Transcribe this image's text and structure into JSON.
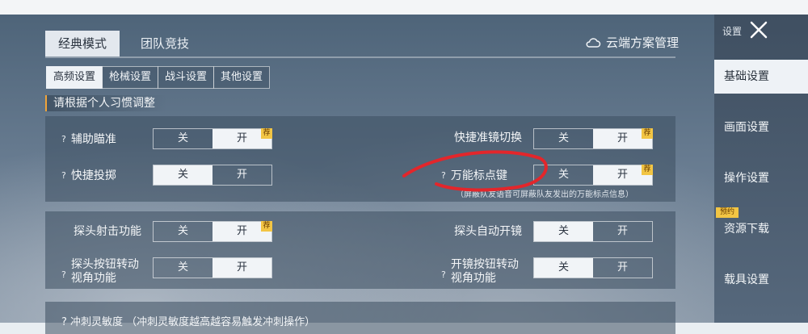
{
  "mode_tabs": [
    "经典模式",
    "团队竞技"
  ],
  "cloud_label": "云端方案管理",
  "sub_tabs": [
    "高频设置",
    "枪械设置",
    "战斗设置",
    "其他设置"
  ],
  "hint": "请根据个人习惯调整",
  "toggle": {
    "off": "关",
    "on": "开",
    "recommend": "荐"
  },
  "panel1": {
    "aim_assist": "辅助瞄准",
    "quick_throw": "快捷投掷",
    "quick_scope_switch": "快捷准镜切换",
    "universal_marker": "万能标点键",
    "marker_note": "（屏蔽队友语音可屏蔽队友发出的万能标点信息）"
  },
  "panel2": {
    "peek_fire": "探头射击功能",
    "peek_button_rotate_1": "探头按钮转动",
    "peek_button_rotate_2": "视角功能",
    "peek_auto_scope": "探头自动开镜",
    "scope_button_rotate_1": "开镜按钮转动",
    "scope_button_rotate_2": "视角功能"
  },
  "panel3": {
    "text": "? 冲刺灵敏度 （冲刺灵敏度越高越容易触发冲刺操作）"
  },
  "sidebar": {
    "title": "设置",
    "items": [
      "基础设置",
      "画面设置",
      "操作设置",
      "资源下载",
      "载具设置"
    ],
    "badge": "预约"
  },
  "states": {
    "aim_assist": "on",
    "quick_throw": "off",
    "quick_scope_switch": "on",
    "universal_marker": "on",
    "peek_fire": "on",
    "peek_button_rotate": "on",
    "peek_auto_scope": "off",
    "scope_button_rotate": "off"
  },
  "colors": {
    "accent": "#f0a43a",
    "recommend": "#f2c544",
    "annotation": "#e3262b"
  }
}
